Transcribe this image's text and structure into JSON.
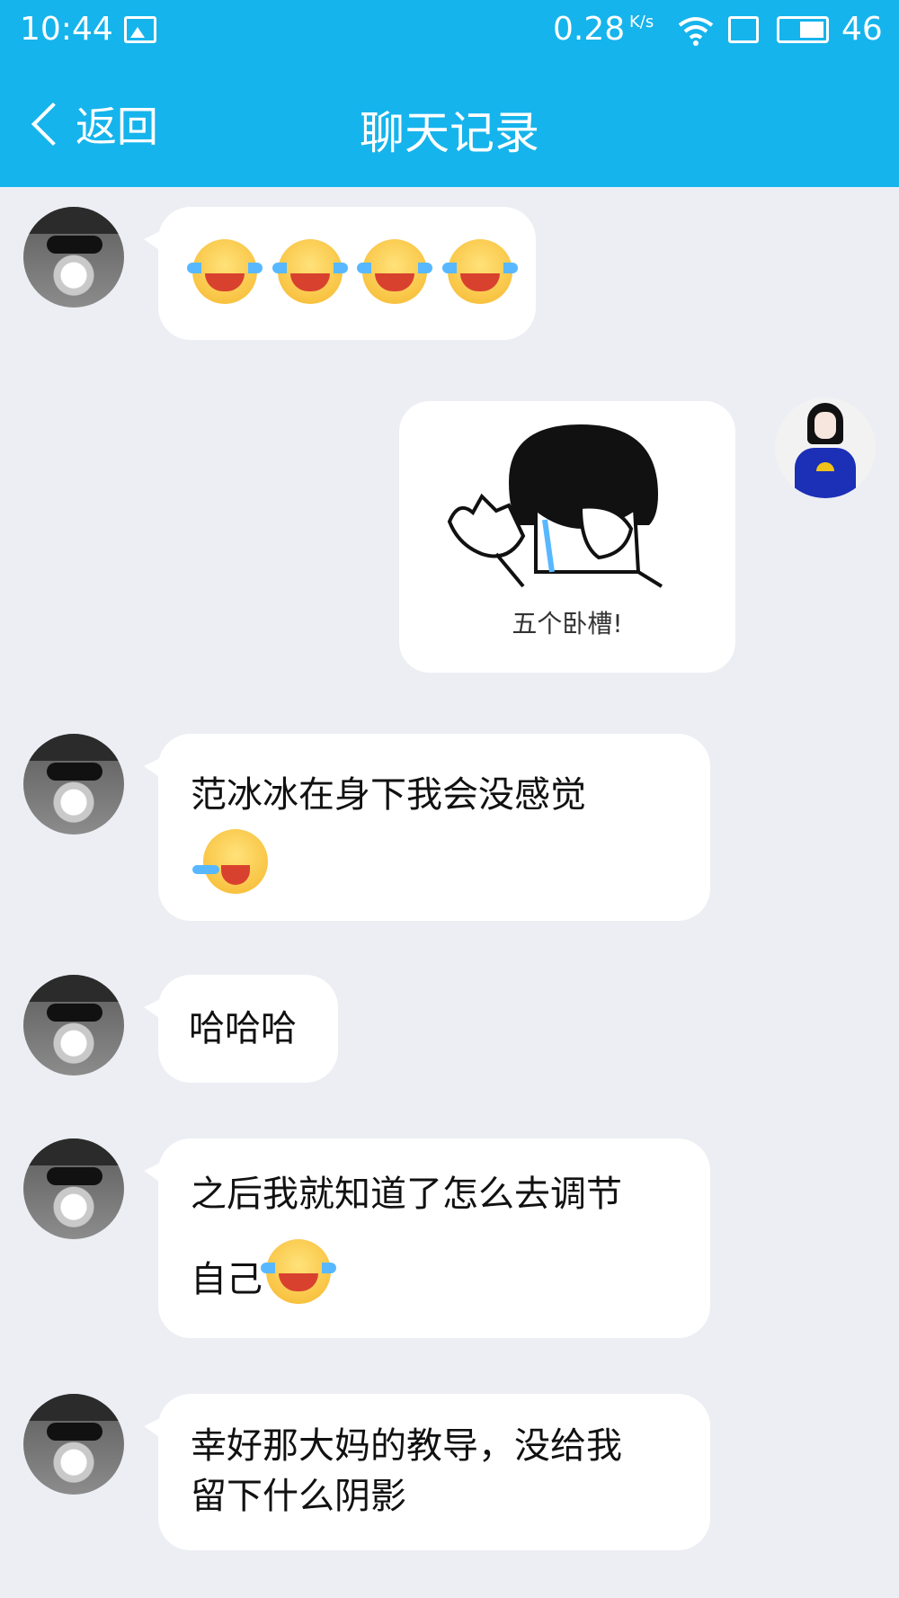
{
  "status_bar": {
    "time": "10:44",
    "network_speed": "0.28",
    "speed_unit": "K/s",
    "battery_level": "46",
    "icons": [
      "image-icon",
      "wifi-icon",
      "sim-icon",
      "battery-icon"
    ]
  },
  "header": {
    "back_label": "返回",
    "title": "聊天记录"
  },
  "messages": [
    {
      "sender": "other",
      "content": "emoji",
      "emoji_count": 4
    },
    {
      "sender": "self",
      "content": "sticker",
      "caption": "五个卧槽!"
    },
    {
      "sender": "other",
      "text": "范冰冰在身下我会没感觉"
    },
    {
      "sender": "other",
      "text": "哈哈哈"
    },
    {
      "sender": "other",
      "line1": "之后我就知道了怎么去调节",
      "line2": "自己"
    },
    {
      "sender": "other",
      "line1": "幸好那大妈的教导，没给我",
      "line2": "留下什么阴影"
    }
  ],
  "colors": {
    "header": "#16b4ec",
    "background": "#eceef3",
    "bubble": "#ffffff"
  }
}
